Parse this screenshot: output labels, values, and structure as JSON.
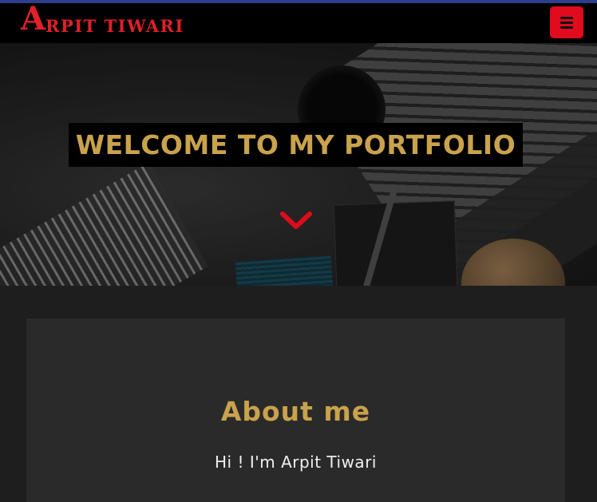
{
  "navbar": {
    "brand_initial": "A",
    "brand_rest": "RPIT TIWARI",
    "menu_icon": "hamburger-menu-icon"
  },
  "hero": {
    "heading": "WELCOME TO MY PORTFOLIO",
    "scroll_icon": "chevron-down-icon"
  },
  "about": {
    "title": "About me",
    "greeting": "Hi ! I'm Arpit Tiwari"
  },
  "colors": {
    "accent": "#e00b1c",
    "gold": "#c9a24c",
    "nav_bg": "#000000",
    "page_bg": "#1e1e1e",
    "card_bg": "#2a2a2a",
    "top_line": "#2d3f8a"
  }
}
